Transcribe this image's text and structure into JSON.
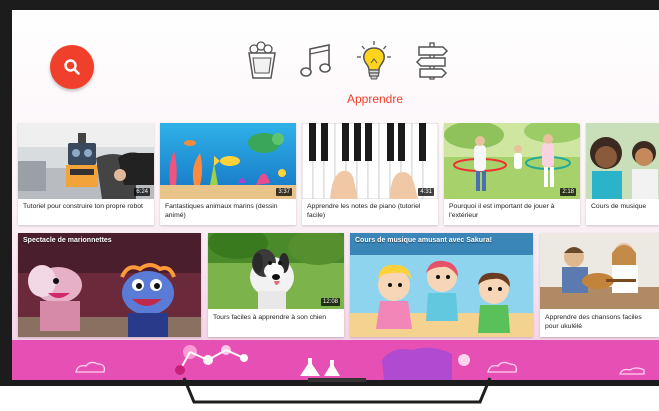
{
  "header": {
    "search_icon": "search-icon",
    "categories": [
      {
        "name": "shows",
        "icon": "popcorn-icon"
      },
      {
        "name": "music",
        "icon": "music-note-icon"
      },
      {
        "name": "learning",
        "icon": "lightbulb-icon"
      },
      {
        "name": "explore",
        "icon": "signpost-icon"
      }
    ],
    "section_title": "Apprendre"
  },
  "colors": {
    "accent": "#f0402c",
    "bottom_band": "#e64fb4"
  },
  "row1": [
    {
      "title": "Tutoriel pour construire ton propre robot",
      "duration": "6:24"
    },
    {
      "title": "Fantastiques animaux marins (dessin animé)",
      "duration": "3:37"
    },
    {
      "title": "Apprendre les notes de piano (tutoriel facile)",
      "duration": "4:31"
    },
    {
      "title": "Pourquoi il est important de jouer à l'extérieur",
      "duration": "2:18"
    },
    {
      "title": "Cours de musique",
      "duration": ""
    }
  ],
  "row2": [
    {
      "title": "Spectacle de marionnettes",
      "duration": ""
    },
    {
      "title": "Tours faciles à apprendre à son chien",
      "duration": "12:08"
    },
    {
      "title": "Cours de musique amusant avec Sakura!",
      "duration": ""
    },
    {
      "title": "Apprendre des chansons faciles pour ukulélé",
      "duration": ""
    }
  ]
}
